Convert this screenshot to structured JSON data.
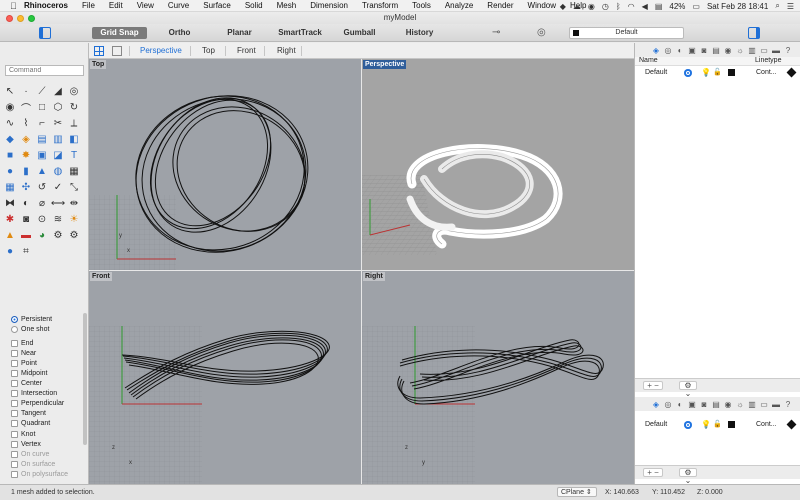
{
  "menubar": {
    "app": "Rhinoceros",
    "items": [
      "File",
      "Edit",
      "View",
      "Curve",
      "Surface",
      "Solid",
      "Mesh",
      "Dimension",
      "Transform",
      "Tools",
      "Analyze",
      "Render",
      "Window",
      "Help"
    ],
    "battery": "42%",
    "datetime": "Sat Feb 28  18:41"
  },
  "window": {
    "title": "myModel"
  },
  "toolbar": {
    "modes": [
      {
        "label": "Grid Snap",
        "active": true
      },
      {
        "label": "Ortho",
        "active": false
      },
      {
        "label": "Planar",
        "active": false
      },
      {
        "label": "SmartTrack",
        "active": false
      },
      {
        "label": "Gumball",
        "active": false
      },
      {
        "label": "History",
        "active": false
      }
    ],
    "current_layer": "Default"
  },
  "command": {
    "placeholder": "Command"
  },
  "viewport_tabs": [
    "Perspective",
    "Top",
    "Front",
    "Right"
  ],
  "active_viewport_tab": "Perspective",
  "viewports": {
    "top": "Top",
    "perspective": "Perspective",
    "front": "Front",
    "right": "Right"
  },
  "osnap": {
    "persistent": "Persistent",
    "one_shot": "One shot",
    "items": [
      "End",
      "Near",
      "Point",
      "Midpoint",
      "Center",
      "Intersection",
      "Perpendicular",
      "Tangent",
      "Quadrant",
      "Knot",
      "Vertex"
    ],
    "dim_items": [
      "On curve",
      "On surface",
      "On polysurface"
    ]
  },
  "layers_panel": {
    "col_name": "Name",
    "col_linetype": "Linetype",
    "rows": [
      {
        "name": "Default",
        "linetype": "Cont..."
      }
    ],
    "add_remove": "+ −",
    "gear": "⚙ ⌄"
  },
  "layers_panel_2": {
    "rows": [
      {
        "name": "Default",
        "linetype": "Cont..."
      }
    ]
  },
  "statusbar": {
    "message": "1 mesh added to selection.",
    "cplane": "CPlane",
    "x": "X: 140.663",
    "y": "Y: 110.452",
    "z": "Z: 0.000"
  }
}
